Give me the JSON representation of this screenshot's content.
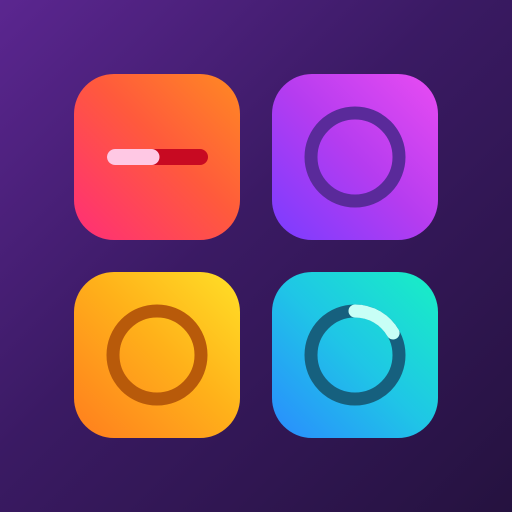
{
  "app_icon": {
    "name": "drum-pad-launcher-icon",
    "colors": {
      "background_top": "#5b2690",
      "background_bottom": "#25123f"
    },
    "tiles": [
      {
        "id": "top-left",
        "glyph": "slider-bar-icon",
        "colors": [
          "#ff2e78",
          "#ff8a22"
        ],
        "bar_fill": 0.52,
        "bar_fill_color": "#ffc8e4",
        "bar_track_color": "#c80a22"
      },
      {
        "id": "top-right",
        "glyph": "ring-icon",
        "colors": [
          "#7a3cff",
          "#e94cf2"
        ],
        "ring_color": "#5a2a9a"
      },
      {
        "id": "bottom-left",
        "glyph": "ring-icon",
        "colors": [
          "#ff7d1e",
          "#ffe027"
        ],
        "ring_color": "#b85a0a"
      },
      {
        "id": "bottom-right",
        "glyph": "progress-ring-icon",
        "colors": [
          "#2a8bff",
          "#18f0c4"
        ],
        "ring_color": "#16607e",
        "highlight_color": "#c8fff6"
      }
    ]
  }
}
